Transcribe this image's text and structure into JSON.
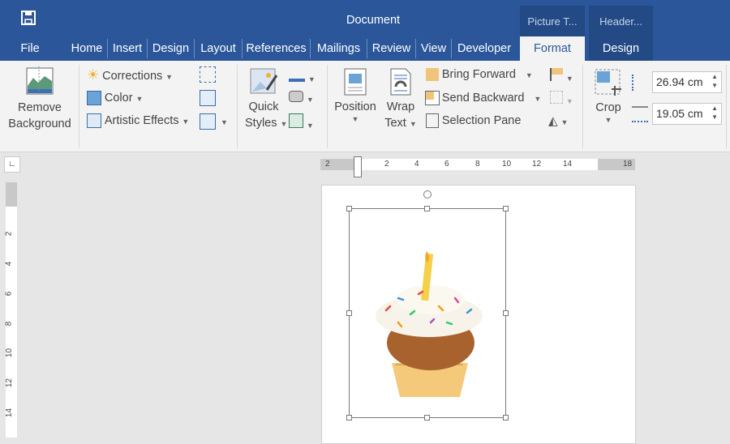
{
  "window": {
    "title": "Document"
  },
  "tabs": [
    "File",
    "Home",
    "Insert",
    "Design",
    "Layout",
    "References",
    "Mailings",
    "Review",
    "View",
    "Developer"
  ],
  "context_tabs": [
    {
      "group": "Picture T...",
      "tab": "Format",
      "active": true
    },
    {
      "group": "Header...",
      "tab": "Design",
      "active": false
    }
  ],
  "ribbon": {
    "remove_background": [
      "Remove",
      "Background"
    ],
    "corrections": "Corrections",
    "color": "Color",
    "artistic_effects": "Artistic Effects",
    "quick_styles": [
      "Quick",
      "Styles"
    ],
    "position": "Position",
    "wrap_text": [
      "Wrap",
      "Text"
    ],
    "bring_forward": "Bring Forward",
    "send_backward": "Send Backward",
    "selection_pane": "Selection Pane",
    "crop": "Crop",
    "height": "26.94 cm",
    "width": "19.05 cm"
  },
  "ruler": {
    "h": [
      "2",
      "2",
      "4",
      "6",
      "8",
      "10",
      "12",
      "14",
      "18"
    ],
    "v": [
      "2",
      "4",
      "6",
      "8",
      "10",
      "12",
      "14"
    ]
  },
  "colors": {
    "brand": "#2b579a",
    "context": "#234a85",
    "ribbon": "#f3f3f3"
  }
}
